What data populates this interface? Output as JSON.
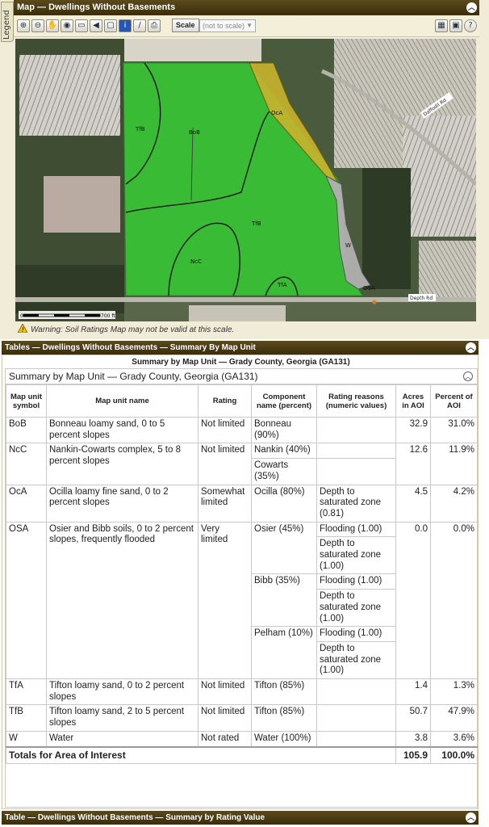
{
  "legend_tab": "Legend",
  "map": {
    "title": "Map — Dwellings Without Basements",
    "scale_button": "Scale",
    "scale_value": "(not to scale)",
    "labels": [
      "TfB",
      "BoB",
      "OcA",
      "TfB",
      "NcC",
      "TfA",
      "W",
      "OSA"
    ],
    "road_label_1": "Daffodil Rd",
    "road_label_2": "Depth Rd",
    "scalebar_start": "0",
    "scalebar_end": "700 ft",
    "warning": "Warning: Soil Ratings Map may not be valid at this scale."
  },
  "tables_panel": {
    "title": "Tables — Dwellings Without Basements — Summary By Map Unit",
    "caption": "Summary by Map Unit — Grady County, Georgia (GA131)",
    "box_title": "Summary by Map Unit — Grady County, Georgia (GA131)",
    "headers": [
      "Map unit symbol",
      "Map unit name",
      "Rating",
      "Component name (percent)",
      "Rating reasons (numeric values)",
      "Acres in AOI",
      "Percent of AOI"
    ],
    "rows": [
      {
        "symbol": "BoB",
        "name": "Bonneau loamy sand, 0 to 5 percent slopes",
        "rating": "Not limited",
        "components": [
          {
            "name": "Bonneau (90%)",
            "reasons": [
              ""
            ]
          }
        ],
        "acres": "32.9",
        "percent": "31.0%"
      },
      {
        "symbol": "NcC",
        "name": "Nankin-Cowarts complex, 5 to 8 percent slopes",
        "rating": "Not limited",
        "components": [
          {
            "name": "Nankin (40%)",
            "reasons": [
              ""
            ]
          },
          {
            "name": "Cowarts (35%)",
            "reasons": [
              ""
            ]
          }
        ],
        "acres": "12.6",
        "percent": "11.9%"
      },
      {
        "symbol": "OcA",
        "name": "Ocilla loamy fine sand, 0 to 2 percent slopes",
        "rating": "Somewhat limited",
        "components": [
          {
            "name": "Ocilla (80%)",
            "reasons": [
              "Depth to saturated zone (0.81)"
            ]
          }
        ],
        "acres": "4.5",
        "percent": "4.2%"
      },
      {
        "symbol": "OSA",
        "name": "Osier and Bibb soils, 0 to 2 percent slopes, frequently flooded",
        "rating": "Very limited",
        "components": [
          {
            "name": "Osier (45%)",
            "reasons": [
              "Flooding (1.00)",
              "Depth to saturated zone (1.00)"
            ]
          },
          {
            "name": "Bibb (35%)",
            "reasons": [
              "Flooding (1.00)",
              "Depth to saturated zone (1.00)"
            ]
          },
          {
            "name": "Pelham (10%)",
            "reasons": [
              "Flooding (1.00)",
              "Depth to saturated zone (1.00)"
            ]
          }
        ],
        "acres": "0.0",
        "percent": "0.0%"
      },
      {
        "symbol": "TfA",
        "name": "Tifton loamy sand, 0 to 2 percent slopes",
        "rating": "Not limited",
        "components": [
          {
            "name": "Tifton (85%)",
            "reasons": [
              ""
            ]
          }
        ],
        "acres": "1.4",
        "percent": "1.3%"
      },
      {
        "symbol": "TfB",
        "name": "Tifton loamy sand, 2 to 5 percent slopes",
        "rating": "Not limited",
        "components": [
          {
            "name": "Tifton (85%)",
            "reasons": [
              ""
            ]
          }
        ],
        "acres": "50.7",
        "percent": "47.9%"
      },
      {
        "symbol": "W",
        "name": "Water",
        "rating": "Not rated",
        "components": [
          {
            "name": "Water (100%)",
            "reasons": [
              ""
            ]
          }
        ],
        "acres": "3.8",
        "percent": "3.6%"
      }
    ],
    "totals": {
      "label": "Totals for Area of Interest",
      "acres": "105.9",
      "percent": "100.0%"
    }
  },
  "bottom_panel": {
    "title": "Table — Dwellings Without Basements — Summary by Rating Value"
  },
  "colors": {
    "panel_header": "#3a2d0a",
    "not_limited": "#33cc33",
    "somewhat_limited": "#c8b42a",
    "not_rated": "#a8a8a8"
  }
}
